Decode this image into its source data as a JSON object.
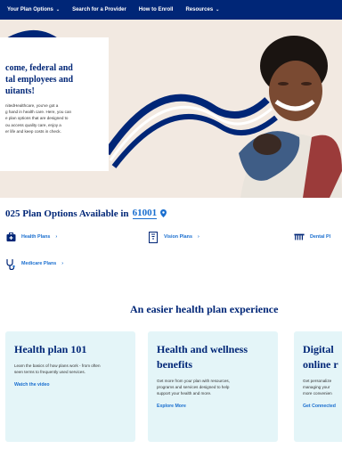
{
  "nav": {
    "items": [
      {
        "label": "Your Plan Options",
        "has_menu": true
      },
      {
        "label": "Search for a Provider",
        "has_menu": false
      },
      {
        "label": "How to Enroll",
        "has_menu": false
      },
      {
        "label": "Resources",
        "has_menu": true
      }
    ],
    "background": "#002677"
  },
  "hero": {
    "title_lines": [
      "come, federal and",
      "tal employees and",
      "uitants!"
    ],
    "text_lines": [
      "nitedHealthcare, you've got a",
      "g hand in health care. Here, you can",
      "e plan options that are designed to",
      "ou access quality care, enjoy a",
      "er life and keep costs in check."
    ]
  },
  "plans": {
    "heading": "025 Plan Options Available in",
    "zip": "61001",
    "links": [
      {
        "label": "Health Plans",
        "icon": "first-aid-kit-icon"
      },
      {
        "label": "Vision Plans",
        "icon": "eye-chart-icon"
      },
      {
        "label": "Dental Pl",
        "icon": "dental-icon"
      },
      {
        "label": "Medicare Plans",
        "icon": "stethoscope-icon"
      }
    ],
    "chevron": "›"
  },
  "experience": {
    "title": "An easier health plan experience",
    "cards": [
      {
        "title_lines": [
          "Health plan 101"
        ],
        "text_lines": [
          "Learn the basics of how plans work - from often",
          "seen terms to frequently used services."
        ],
        "link": "Watch the video"
      },
      {
        "title_lines": [
          "Health and wellness",
          "benefits"
        ],
        "text_lines": [
          "Get more from your plan with resources,",
          "programs and services designed to help",
          "support your health and more."
        ],
        "link": "Explore More"
      },
      {
        "title_lines": [
          "Digital",
          "online r"
        ],
        "text_lines": [
          "Get personalize",
          "managing your",
          "more convenien"
        ],
        "link": "Get Connected"
      }
    ]
  },
  "colors": {
    "brand_navy": "#002677",
    "link_blue": "#196ecf",
    "card_bg": "#e4f5f8"
  }
}
